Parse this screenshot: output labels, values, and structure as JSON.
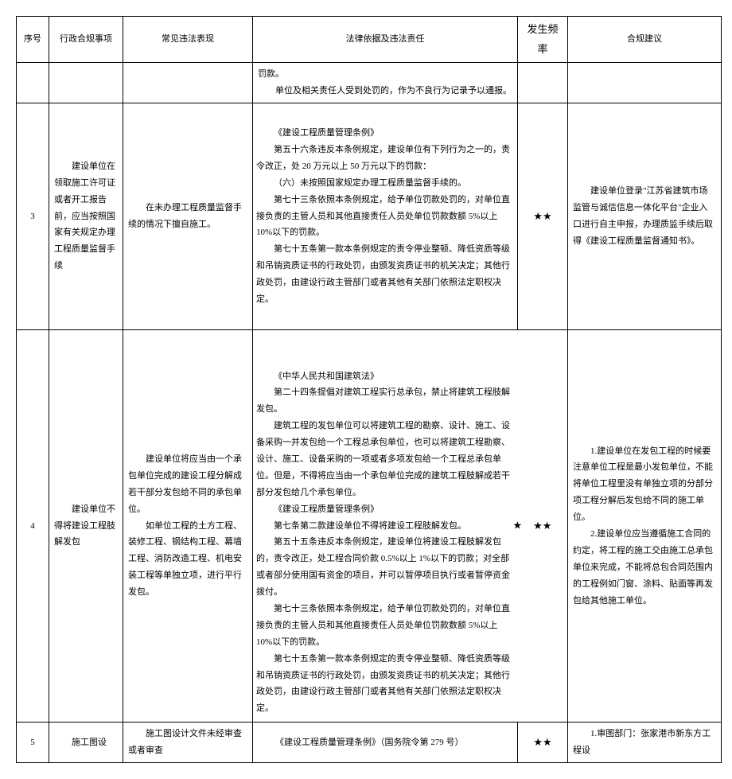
{
  "headers": {
    "seq": "序号",
    "matter": "行政合规事项",
    "violation": "常见违法表现",
    "legal": "法律依据及违法责任",
    "freq": "发生频率",
    "suggest": "合规建议"
  },
  "rows": [
    {
      "seq": "",
      "matter": "",
      "violation": "",
      "legal_lines": [
        "罚款。",
        "单位及相关责任人受到处罚的，作为不良行为记录予以通报。"
      ],
      "freq": "",
      "suggest": ""
    },
    {
      "seq": "3",
      "matter": "建设单位在领取施工许可证或者开工报告前，应当按照国家有关规定办理工程质量监督手续",
      "violation": "在未办理工程质量监督手续的情况下擅自施工。",
      "legal_lines": [
        "《建设工程质量管理条例》",
        "第五十六条违反本条例规定，建设单位有下列行为之一的，责令改正，处 20 万元以上 50 万元以下的罚款：",
        "（六）未按照国家规定办理工程质量监督手续的。",
        "第七十三条依照本条例规定，给予单位罚款处罚的，对单位直接负责的主管人员和其他直接责任人员处单位罚款数额 5%以上 10%以下的罚款。",
        "第七十五条第一款本条例规定的责令停业整顿、降低资质等级和吊销资质证书的行政处罚，由颁发资质证书的机关决定；其他行政处罚，由建设行政主管部门或者其他有关部门依照法定职权决定。"
      ],
      "freq": "★★",
      "suggest": "建设单位登录\"江苏省建筑市场监管与诚信信息一体化平台\"企业入口进行自主申报，办理质监手续后取得《建设工程质量监督通知书》。"
    },
    {
      "seq": "4",
      "matter": "建设单位不得将建设工程肢解发包",
      "violation_lines": [
        "建设单位将应当由一个承包单位完成的建设工程分解成若干部分发包给不同的承包单位。",
        "如单位工程的土方工程、装修工程、钢结构工程、幕墙工程、消防改造工程、机电安装工程等单独立项，进行平行发包。"
      ],
      "legal_lines": [
        "《中华人民共和国建筑法》",
        "第二十四条提倡对建筑工程实行总承包，禁止将建筑工程肢解发包。",
        "建筑工程的发包单位可以将建筑工程的勘察、设计、施工、设备采购一并发包给一个工程总承包单位，也可以将建筑工程勘察、设计、施工、设备采购的一项或者多项发包给一个工程总承包单位。但是，不得将应当由一个承包单位完成的建筑工程肢解成若干部分发包给几个承包单位。",
        "《建设工程质量管理条例》",
        "第七条第二款建设单位不得将建设工程肢解发包。",
        "第五十五条违反本条例规定，建设单位将建设工程肢解发包的，责令改正，处工程合同价款 0.5%以上 1%以下的罚款；对全部或者部分使用国有资金的项目，并可以暂停项目执行或者暂停资金拨付。",
        "第七十三条依照本条例规定，给予单位罚款处罚的，对单位直接负责的主管人员和其他直接责任人员处单位罚款数额 5%以上 10%以下的罚款。",
        "第七十五条第一款本条例规定的责令停业整顿、降低资质等级和吊销资质证书的行政处罚，由颁发资质证书的机关决定；其他行政处罚，由建设行政主管部门或者其他有关部门依照法定职权决定。"
      ],
      "freq_left": "★",
      "freq_right": "★★",
      "suggest_lines": [
        "1.建设单位在发包工程的时候要注意单位工程是最小发包单位，不能将单位工程里没有单独立项的分部分项工程分解后发包给不同的施工单位。",
        "2.建设单位应当遵循施工合同的约定，将工程的施工交由施工总承包单位来完成，不能将总包合同范围内的工程例如门窗、涂料、贴面等再发包给其他施工单位。"
      ]
    },
    {
      "seq": "5",
      "matter": "施工图设",
      "violation": "施工图设计文件未经审查或者审查",
      "legal": "《建设工程质量管理条例》（国务院令第 279 号）",
      "freq": "★★",
      "suggest": "1.审图部门：张家港市新东方工程设"
    }
  ]
}
